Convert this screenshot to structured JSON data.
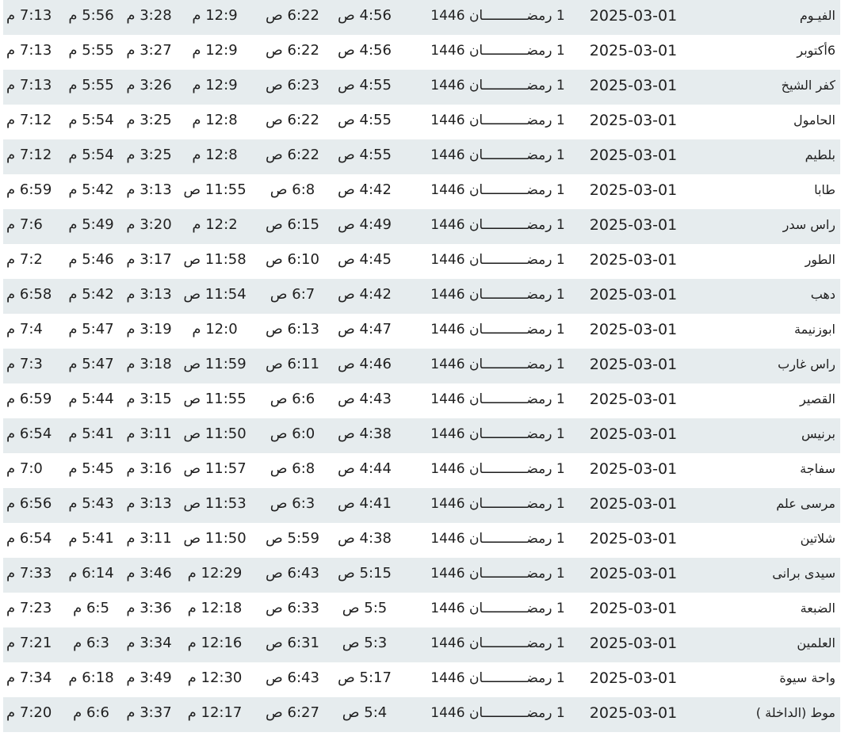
{
  "rows": [
    {
      "city": "الفيـوم",
      "date": "2025-03-01",
      "hijri": "1 رمضـــــــــــان 1446",
      "fajr": "4:56 ص",
      "sunrise": "6:22 ص",
      "dhuhr": "12:9 م",
      "asr": "3:28 م",
      "maghrib": "5:56 م",
      "isha": "7:13 م"
    },
    {
      "city": "6أكتوبر",
      "date": "2025-03-01",
      "hijri": "1 رمضـــــــــــان 1446",
      "fajr": "4:56 ص",
      "sunrise": "6:22 ص",
      "dhuhr": "12:9 م",
      "asr": "3:27 م",
      "maghrib": "5:55 م",
      "isha": "7:13 م"
    },
    {
      "city": "كفر الشيخ",
      "date": "2025-03-01",
      "hijri": "1 رمضـــــــــــان 1446",
      "fajr": "4:55 ص",
      "sunrise": "6:23 ص",
      "dhuhr": "12:9 م",
      "asr": "3:26 م",
      "maghrib": "5:55 م",
      "isha": "7:13 م"
    },
    {
      "city": "الحامول",
      "date": "2025-03-01",
      "hijri": "1 رمضـــــــــــان 1446",
      "fajr": "4:55 ص",
      "sunrise": "6:22 ص",
      "dhuhr": "12:8 م",
      "asr": "3:25 م",
      "maghrib": "5:54 م",
      "isha": "7:12 م"
    },
    {
      "city": "بلطيم",
      "date": "2025-03-01",
      "hijri": "1 رمضـــــــــــان 1446",
      "fajr": "4:55 ص",
      "sunrise": "6:22 ص",
      "dhuhr": "12:8 م",
      "asr": "3:25 م",
      "maghrib": "5:54 م",
      "isha": "7:12 م"
    },
    {
      "city": "طابا",
      "date": "2025-03-01",
      "hijri": "1 رمضـــــــــــان 1446",
      "fajr": "4:42 ص",
      "sunrise": "6:8 ص",
      "dhuhr": "11:55 ص",
      "asr": "3:13 م",
      "maghrib": "5:42 م",
      "isha": "6:59 م"
    },
    {
      "city": "راس سدر",
      "date": "2025-03-01",
      "hijri": "1 رمضـــــــــــان 1446",
      "fajr": "4:49 ص",
      "sunrise": "6:15 ص",
      "dhuhr": "12:2 م",
      "asr": "3:20 م",
      "maghrib": "5:49 م",
      "isha": "7:6 م"
    },
    {
      "city": "الطور",
      "date": "2025-03-01",
      "hijri": "1 رمضـــــــــــان 1446",
      "fajr": "4:45 ص",
      "sunrise": "6:10 ص",
      "dhuhr": "11:58 ص",
      "asr": "3:17 م",
      "maghrib": "5:46 م",
      "isha": "7:2 م"
    },
    {
      "city": "دهب",
      "date": "2025-03-01",
      "hijri": "1 رمضـــــــــــان 1446",
      "fajr": "4:42 ص",
      "sunrise": "6:7 ص",
      "dhuhr": "11:54 ص",
      "asr": "3:13 م",
      "maghrib": "5:42 م",
      "isha": "6:58 م"
    },
    {
      "city": "ابوزنيمة",
      "date": "2025-03-01",
      "hijri": "1 رمضـــــــــــان 1446",
      "fajr": "4:47 ص",
      "sunrise": "6:13 ص",
      "dhuhr": "12:0 م",
      "asr": "3:19 م",
      "maghrib": "5:47 م",
      "isha": "7:4 م"
    },
    {
      "city": "راس غارب",
      "date": "2025-03-01",
      "hijri": "1 رمضـــــــــــان 1446",
      "fajr": "4:46 ص",
      "sunrise": "6:11 ص",
      "dhuhr": "11:59 ص",
      "asr": "3:18 م",
      "maghrib": "5:47 م",
      "isha": "7:3 م"
    },
    {
      "city": "القصير",
      "date": "2025-03-01",
      "hijri": "1 رمضـــــــــــان 1446",
      "fajr": "4:43 ص",
      "sunrise": "6:6 ص",
      "dhuhr": "11:55 ص",
      "asr": "3:15 م",
      "maghrib": "5:44 م",
      "isha": "6:59 م"
    },
    {
      "city": "برنيس",
      "date": "2025-03-01",
      "hijri": "1 رمضـــــــــــان 1446",
      "fajr": "4:38 ص",
      "sunrise": "6:0 ص",
      "dhuhr": "11:50 ص",
      "asr": "3:11 م",
      "maghrib": "5:41 م",
      "isha": "6:54 م"
    },
    {
      "city": "سفاجة",
      "date": "2025-03-01",
      "hijri": "1 رمضـــــــــــان 1446",
      "fajr": "4:44 ص",
      "sunrise": "6:8 ص",
      "dhuhr": "11:57 ص",
      "asr": "3:16 م",
      "maghrib": "5:45 م",
      "isha": "7:0 م"
    },
    {
      "city": "مرسى علم",
      "date": "2025-03-01",
      "hijri": "1 رمضـــــــــــان 1446",
      "fajr": "4:41 ص",
      "sunrise": "6:3 ص",
      "dhuhr": "11:53 ص",
      "asr": "3:13 م",
      "maghrib": "5:43 م",
      "isha": "6:56 م"
    },
    {
      "city": "شلاتين",
      "date": "2025-03-01",
      "hijri": "1 رمضـــــــــــان 1446",
      "fajr": "4:38 ص",
      "sunrise": "5:59 ص",
      "dhuhr": "11:50 ص",
      "asr": "3:11 م",
      "maghrib": "5:41 م",
      "isha": "6:54 م"
    },
    {
      "city": "سيدى برانى",
      "date": "2025-03-01",
      "hijri": "1 رمضـــــــــــان 1446",
      "fajr": "5:15 ص",
      "sunrise": "6:43 ص",
      "dhuhr": "12:29 م",
      "asr": "3:46 م",
      "maghrib": "6:14 م",
      "isha": "7:33 م"
    },
    {
      "city": "الضبعة",
      "date": "2025-03-01",
      "hijri": "1 رمضـــــــــــان 1446",
      "fajr": "5:5 ص",
      "sunrise": "6:33 ص",
      "dhuhr": "12:18 م",
      "asr": "3:36 م",
      "maghrib": "6:5 م",
      "isha": "7:23 م"
    },
    {
      "city": "العلمين",
      "date": "2025-03-01",
      "hijri": "1 رمضـــــــــــان 1446",
      "fajr": "5:3 ص",
      "sunrise": "6:31 ص",
      "dhuhr": "12:16 م",
      "asr": "3:34 م",
      "maghrib": "6:3 م",
      "isha": "7:21 م"
    },
    {
      "city": "واحة سيوة",
      "date": "2025-03-01",
      "hijri": "1 رمضـــــــــــان 1446",
      "fajr": "5:17 ص",
      "sunrise": "6:43 ص",
      "dhuhr": "12:30 م",
      "asr": "3:49 م",
      "maghrib": "6:18 م",
      "isha": "7:34 م"
    },
    {
      "city": "موط (الداخلة )",
      "date": "2025-03-01",
      "hijri": "1 رمضـــــــــــان 1446",
      "fajr": "5:4 ص",
      "sunrise": "6:27 ص",
      "dhuhr": "12:17 م",
      "asr": "3:37 م",
      "maghrib": "6:6 م",
      "isha": "7:20 م"
    }
  ],
  "colors": {
    "stripe": "#e6ecee",
    "background": "#ffffff",
    "text": "#1f1f1f"
  }
}
